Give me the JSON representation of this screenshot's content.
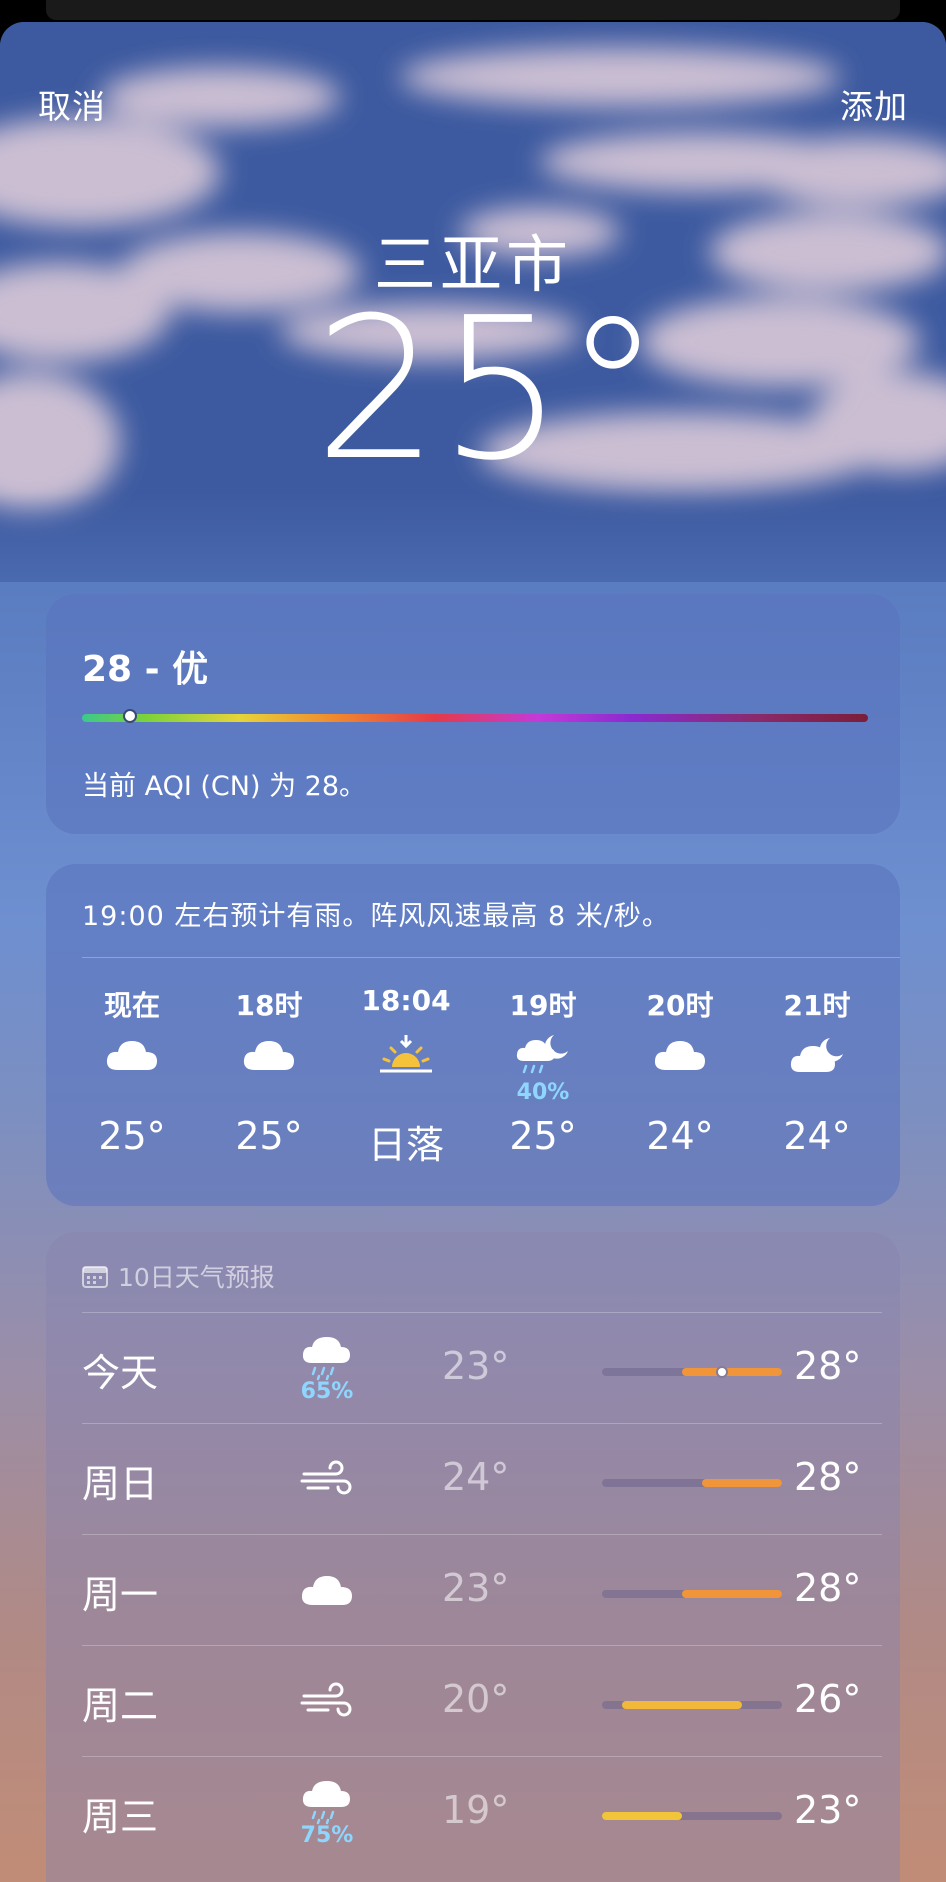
{
  "nav": {
    "cancel_label": "取消",
    "add_label": "添加"
  },
  "location": {
    "city": "三亚市",
    "temperature": "25°"
  },
  "aqi": {
    "title": "28 - 优",
    "description": "当前 AQI (CN) 为 28。",
    "level_fraction": 0.06
  },
  "hourly": {
    "summary": "19:00 左右预计有雨。阵风风速最高 8 米/秒。",
    "items": [
      {
        "label": "现在",
        "icon": "cloud-icon",
        "prob": "",
        "temp": "25°"
      },
      {
        "label": "18时",
        "icon": "cloud-icon",
        "prob": "",
        "temp": "25°"
      },
      {
        "label": "18:04",
        "icon": "sunset-icon",
        "prob": "",
        "temp": "日落"
      },
      {
        "label": "19时",
        "icon": "moon-cloud-rain-icon",
        "prob": "40%",
        "temp": "25°"
      },
      {
        "label": "20时",
        "icon": "cloud-icon",
        "prob": "",
        "temp": "24°"
      },
      {
        "label": "21时",
        "icon": "moon-cloud-icon",
        "prob": "",
        "temp": "24°"
      }
    ]
  },
  "daily": {
    "header": "10日天气预报",
    "range_min": 19,
    "range_max": 28,
    "items": [
      {
        "day": "今天",
        "icon": "cloud-rain-icon",
        "prob": "65%",
        "low": "23°",
        "high": "28°",
        "low_val": 23,
        "high_val": 28,
        "current_val": 25,
        "color": "#f0953a"
      },
      {
        "day": "周日",
        "icon": "wind-icon",
        "prob": "",
        "low": "24°",
        "high": "28°",
        "low_val": 24,
        "high_val": 28,
        "current_val": null,
        "color": "#f0953a"
      },
      {
        "day": "周一",
        "icon": "cloud-icon",
        "prob": "",
        "low": "23°",
        "high": "28°",
        "low_val": 23,
        "high_val": 28,
        "current_val": null,
        "color": "#f0953a"
      },
      {
        "day": "周二",
        "icon": "wind-icon",
        "prob": "",
        "low": "20°",
        "high": "26°",
        "low_val": 20,
        "high_val": 26,
        "current_val": null,
        "color": "#f2b83a"
      },
      {
        "day": "周三",
        "icon": "cloud-rain-icon",
        "prob": "75%",
        "low": "19°",
        "high": "23°",
        "low_val": 19,
        "high_val": 23,
        "current_val": null,
        "color": "#f2c43a"
      }
    ]
  }
}
